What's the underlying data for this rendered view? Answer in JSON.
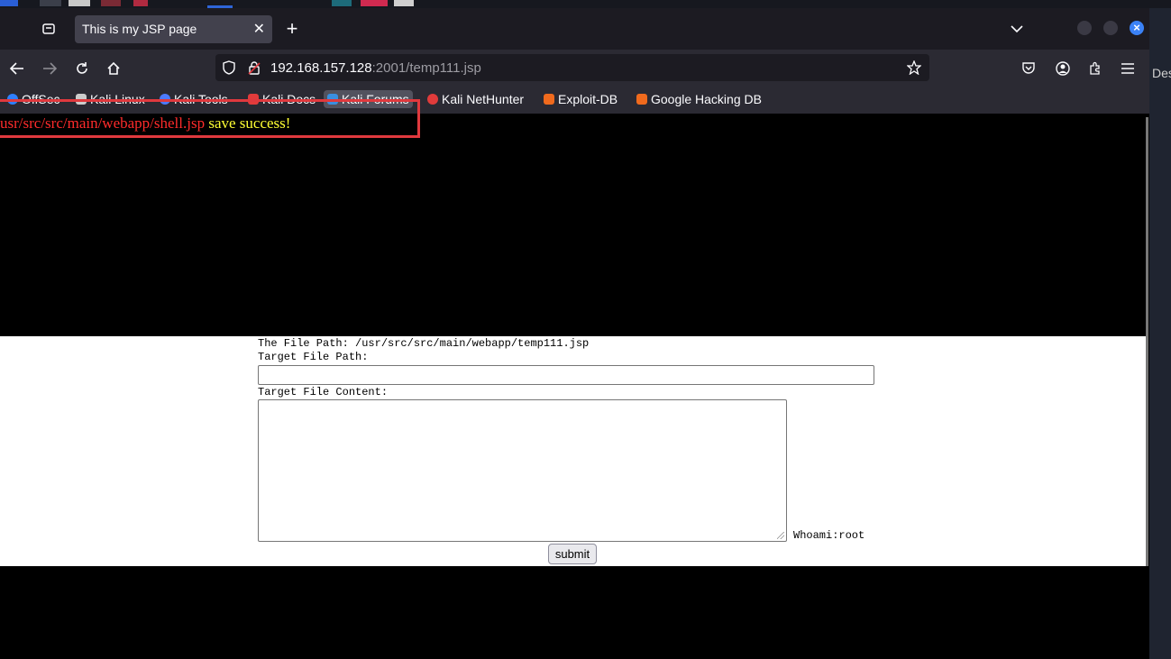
{
  "colors": {
    "tabbar_bg": "#1c1b22",
    "toolbar_bg": "#2b2a33",
    "accent_blue": "#3b82f6",
    "message_path": "#ff2b2b",
    "message_success": "#ffff33",
    "annotation_box": "#e0393e"
  },
  "browser": {
    "tab": {
      "title": "This is my JSP page",
      "close_icon": "close-icon"
    },
    "url": {
      "host": "192.168.157.128",
      "rest": ":2001/temp111.jsp"
    },
    "bookmarks": [
      {
        "label": "OffSec",
        "icon": "offsec-icon",
        "color": "#2f80ff"
      },
      {
        "label": "Kali Linux",
        "icon": "kali-dragon-icon",
        "color": "#cccccc"
      },
      {
        "label": "Kali Tools",
        "icon": "kali-tools-icon",
        "color": "#4c7bff"
      },
      {
        "label": "Kali Docs",
        "icon": "kali-docs-icon",
        "color": "#e23b3b"
      },
      {
        "label": "Kali Forums",
        "icon": "kali-forums-icon",
        "color": "#3a8fe0"
      },
      {
        "label": "Kali NetHunter",
        "icon": "nethunter-icon",
        "color": "#e03b3b"
      },
      {
        "label": "Exploit-DB",
        "icon": "exploit-db-icon",
        "color": "#f06a1d"
      },
      {
        "label": "Google Hacking DB",
        "icon": "ghdb-icon",
        "color": "#f06a1d"
      }
    ]
  },
  "side_panel": {
    "label": "Des"
  },
  "page": {
    "message": {
      "path": "usr/src/src/main/webapp/shell.jsp",
      "status": " save success!"
    },
    "file_path_line": "The File Path: /usr/src/src/main/webapp/temp111.jsp",
    "target_path_label": "Target File Path:",
    "target_path_value": "",
    "target_content_label": "Target File Content:",
    "target_content_value": "",
    "whoami": "Whoami:root",
    "submit_label": "submit"
  }
}
